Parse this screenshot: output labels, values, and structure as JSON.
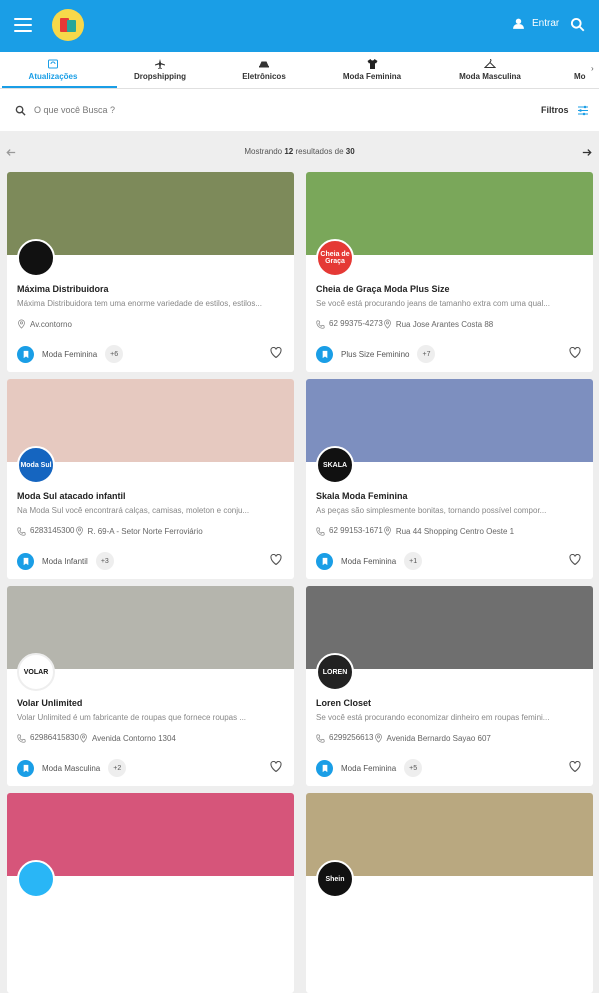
{
  "header": {
    "login_label": "Entrar"
  },
  "tabs": [
    {
      "label": "Atualizações"
    },
    {
      "label": "Dropshipping"
    },
    {
      "label": "Eletrônicos"
    },
    {
      "label": "Moda Feminina"
    },
    {
      "label": "Moda Masculina"
    },
    {
      "label": "Mo"
    }
  ],
  "search": {
    "placeholder": "O que você Busca ?",
    "filters_label": "Filtros"
  },
  "pager": {
    "prefix": "Mostrando",
    "shown": "12",
    "middle": "resultados de",
    "total": "30"
  },
  "stores": [
    {
      "name": "Máxima Distribuidora",
      "description": "Máxima Distribuidora tem uma enorme variedade de estilos, estilos...",
      "phone": "",
      "address": "Av.contorno",
      "category": "Moda Feminina",
      "more": "+6",
      "avatar_text": "",
      "avatar_color": "#111111",
      "banner_color": "#7d8a5a"
    },
    {
      "name": "Cheia de Graça Moda Plus Size",
      "description": "Se você está procurando jeans de tamanho extra com uma qual...",
      "phone": "62 99375-4273",
      "address": "Rua Jose Arantes Costa 88",
      "category": "Plus Size Feminino",
      "more": "+7",
      "avatar_text": "Cheia de Graça",
      "avatar_color": "#e53935",
      "banner_color": "#7aa75a"
    },
    {
      "name": "Moda Sul atacado infantil",
      "description": "Na Moda Sul você encontrará calças, camisas, moleton e conju...",
      "phone": "6283145300",
      "address": "R. 69-A - Setor Norte Ferroviário",
      "category": "Moda Infantil",
      "more": "+3",
      "avatar_text": "Moda Sul",
      "avatar_color": "#1565c0",
      "banner_color": "#e6c9c0"
    },
    {
      "name": "Skala Moda Feminina",
      "description": "As peças são simplesmente bonitas, tornando possível compor...",
      "phone": "62 99153-1671",
      "address": "Rua 44 Shopping Centro Oeste 1",
      "category": "Moda Feminina",
      "more": "+1",
      "avatar_text": "SKALA",
      "avatar_color": "#111111",
      "banner_color": "#7d8fbf"
    },
    {
      "name": "Volar Unlimited",
      "description": "Volar Unlimited é um fabricante de roupas que fornece roupas ...",
      "phone": "62986415830",
      "address": "Avenida Contorno 1304",
      "category": "Moda Masculina",
      "more": "+2",
      "avatar_text": "VOLAR",
      "avatar_color": "#ffffff",
      "banner_color": "#b5b5ad"
    },
    {
      "name": "Loren Closet",
      "description": "Se você está procurando economizar dinheiro em roupas femini...",
      "phone": "6299256613",
      "address": "Avenida Bernardo Sayao 607",
      "category": "Moda Feminina",
      "more": "+5",
      "avatar_text": "LOREN",
      "avatar_color": "#222222",
      "banner_color": "#6f6f6f"
    },
    {
      "name": "",
      "description": "",
      "phone": "",
      "address": "",
      "category": "",
      "more": "",
      "avatar_text": "",
      "avatar_color": "#29b6f6",
      "banner_color": "#d6557a"
    },
    {
      "name": "",
      "description": "",
      "phone": "",
      "address": "",
      "category": "",
      "more": "",
      "avatar_text": "Shein",
      "avatar_color": "#111111",
      "banner_color": "#b9a880"
    }
  ]
}
